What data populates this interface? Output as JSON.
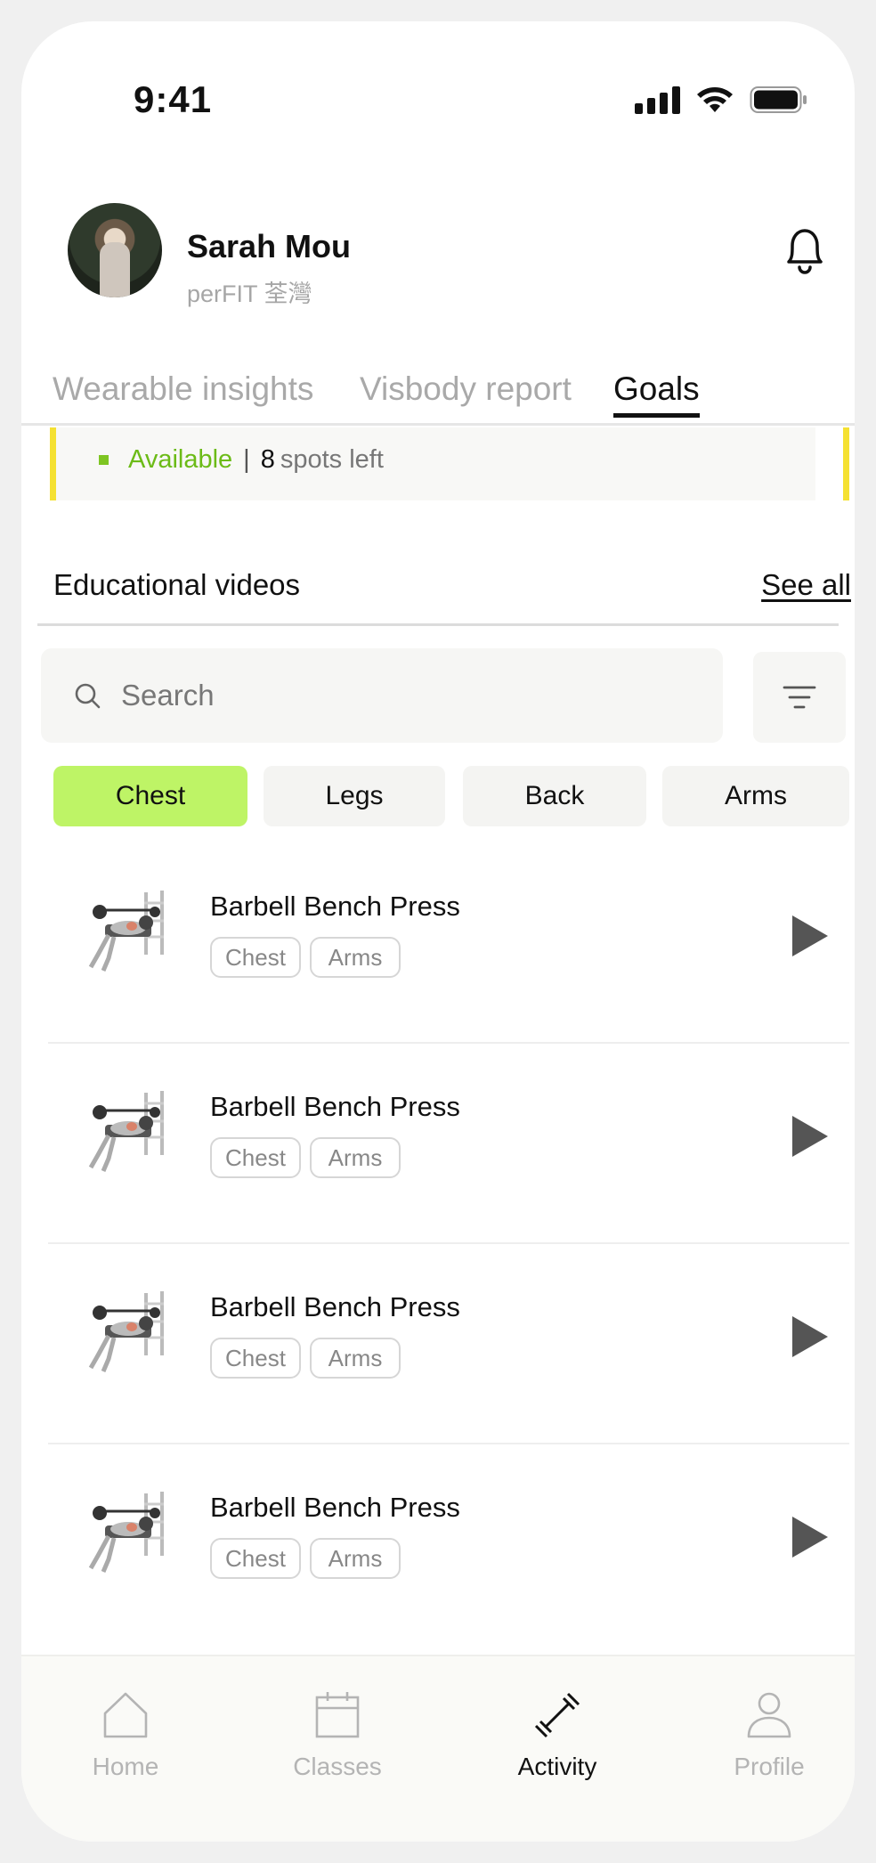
{
  "status_bar": {
    "time": "9:41"
  },
  "user": {
    "name": "Sarah Mou",
    "gym": "perFIT 荃灣"
  },
  "tabs": [
    {
      "label": "Wearable insights",
      "active": false
    },
    {
      "label": "Visbody report",
      "active": false
    },
    {
      "label": "Goals",
      "active": true
    }
  ],
  "availability": {
    "status": "Available",
    "separator": "|",
    "count": "8",
    "spots_label": "spots left"
  },
  "section": {
    "title": "Educational videos",
    "see_all": "See all"
  },
  "search": {
    "placeholder": "Search",
    "value": ""
  },
  "categories": [
    {
      "label": "Chest",
      "active": true
    },
    {
      "label": "Legs",
      "active": false
    },
    {
      "label": "Back",
      "active": false
    },
    {
      "label": "Arms",
      "active": false
    }
  ],
  "videos": [
    {
      "title": "Barbell Bench Press",
      "tags": [
        "Chest",
        "Arms"
      ]
    },
    {
      "title": "Barbell Bench Press",
      "tags": [
        "Chest",
        "Arms"
      ]
    },
    {
      "title": "Barbell Bench Press",
      "tags": [
        "Chest",
        "Arms"
      ]
    },
    {
      "title": "Barbell Bench Press",
      "tags": [
        "Chest",
        "Arms"
      ]
    }
  ],
  "bottom_nav": [
    {
      "label": "Home",
      "icon": "home-icon",
      "active": false
    },
    {
      "label": "Classes",
      "icon": "calendar-icon",
      "active": false
    },
    {
      "label": "Activity",
      "icon": "dumbbell-icon",
      "active": true
    },
    {
      "label": "Profile",
      "icon": "person-icon",
      "active": false
    }
  ],
  "colors": {
    "accent": "#bef466",
    "available": "#6cbb17",
    "highlight": "#f5e132"
  }
}
